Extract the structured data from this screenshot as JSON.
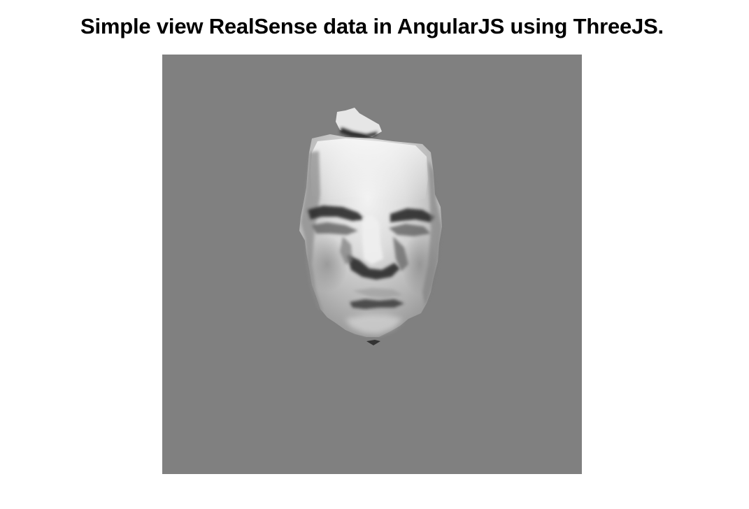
{
  "page": {
    "title": "Simple view RealSense data in AngularJS using ThreeJS."
  },
  "viewer": {
    "background_color": "#808080",
    "content": "face-mesh"
  }
}
